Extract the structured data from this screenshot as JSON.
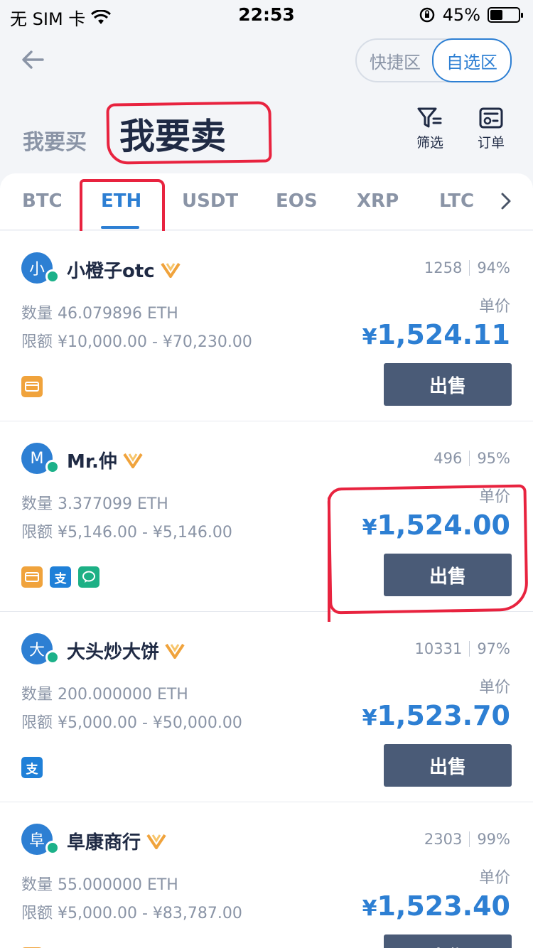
{
  "status_bar": {
    "carrier": "无 SIM 卡",
    "time": "22:53",
    "battery": "45%",
    "battery_level": 0.45
  },
  "header": {
    "segment": [
      "快捷区",
      "自选区"
    ],
    "mode_buy": "我要买",
    "mode_sell": "我要卖",
    "filter_label": "筛选",
    "orders_label": "订单"
  },
  "tabs": [
    "BTC",
    "ETH",
    "USDT",
    "EOS",
    "XRP",
    "LTC"
  ],
  "price_label": "单价",
  "sell_label": "出售",
  "listings": [
    {
      "avatar": "小",
      "name": "小橙子otc",
      "trades": "1258",
      "rate": "94%",
      "quantity": "数量 46.079896 ETH",
      "limit": "限额 ¥10,000.00 - ¥70,230.00",
      "yen": "¥",
      "price": "1,524.11",
      "payments": [
        "bank"
      ]
    },
    {
      "avatar": "M",
      "name": "Mr.仲",
      "trades": "496",
      "rate": "95%",
      "quantity": "数量 3.377099 ETH",
      "limit": "限额 ¥5,146.00 - ¥5,146.00",
      "yen": "¥",
      "price": "1,524.00",
      "payments": [
        "bank",
        "alipay",
        "wechat"
      ]
    },
    {
      "avatar": "大",
      "name": "大头炒大饼",
      "trades": "10331",
      "rate": "97%",
      "quantity": "数量 200.000000 ETH",
      "limit": "限额 ¥5,000.00 - ¥50,000.00",
      "yen": "¥",
      "price": "1,523.70",
      "payments": [
        "alipay"
      ]
    },
    {
      "avatar": "阜",
      "name": "阜康商行",
      "trades": "2303",
      "rate": "99%",
      "quantity": "数量 55.000000 ETH",
      "limit": "限额 ¥5,000.00 - ¥83,787.00",
      "yen": "¥",
      "price": "1,523.40",
      "payments": [
        "bank"
      ]
    }
  ],
  "pay_glyphs": {
    "alipay": "支"
  },
  "colors": {
    "accent": "#2d7fd3",
    "sell_button": "#4a5b77",
    "annotation": "#e8233f"
  }
}
